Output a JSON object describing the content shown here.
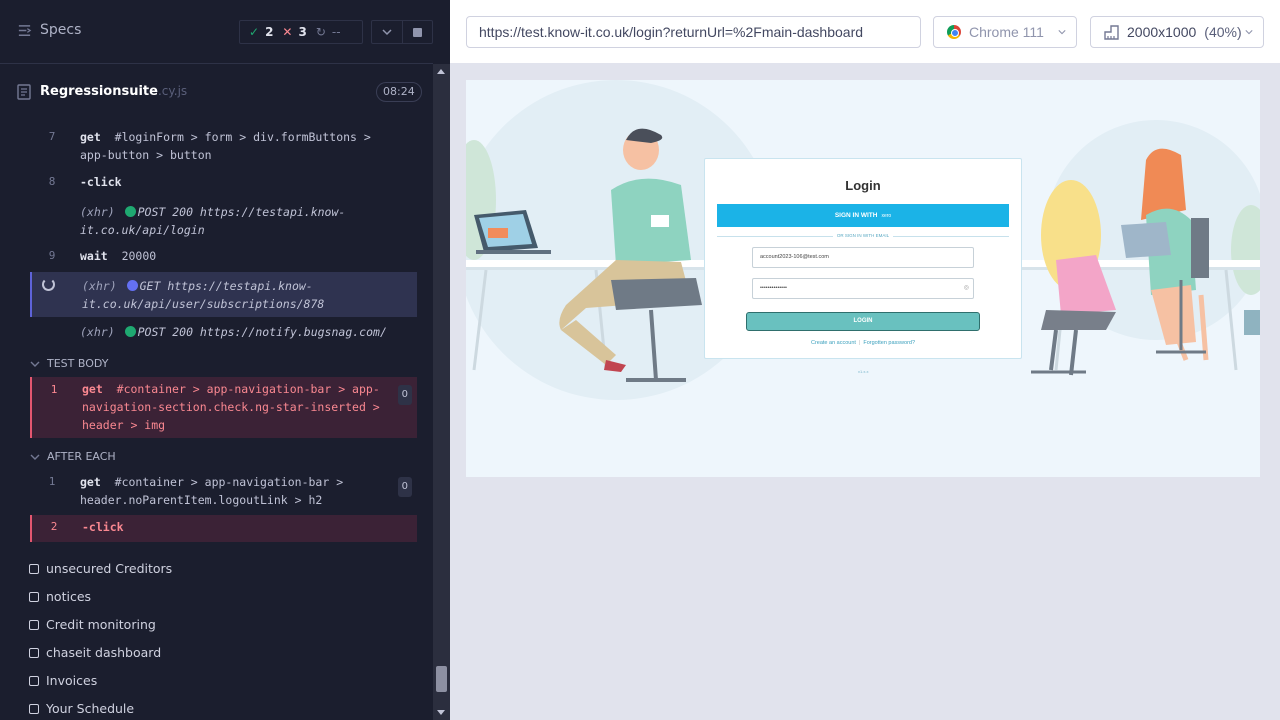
{
  "reporter": {
    "specs_label": "Specs",
    "stats": {
      "passed": "2",
      "failed": "3",
      "pending": "--"
    },
    "spec_name": "Regressionsuite",
    "spec_ext": ".cy.js",
    "duration": "08:24",
    "commands": [
      {
        "num": "7",
        "method": "get",
        "message": "#loginForm > form > div.formButtons > app-button > button"
      },
      {
        "num": "8",
        "method": "-click",
        "message": ""
      },
      {
        "num": "",
        "method": "(xhr)",
        "message": "POST 200 https://testapi.know-it.co.uk/api/login",
        "dot_color": "#1fa971"
      },
      {
        "num": "9",
        "method": "wait",
        "message": "20000"
      },
      {
        "num": "",
        "method": "(xhr)",
        "message": "GET https://testapi.know-it.co.uk/api/user/subscriptions/878",
        "dot_color": "#6470f3"
      },
      {
        "num": "",
        "method": "(xhr)",
        "message": "POST 200 https://notify.bugsnag.com/",
        "dot_color": "#1fa971"
      }
    ],
    "test_body_label": "TEST BODY",
    "test_body_commands": [
      {
        "num": "1",
        "method": "get",
        "message": "#container > app-navigation-bar > app-navigation-section.check.ng-star-inserted > header > img",
        "badge": "0"
      }
    ],
    "after_each_label": "AFTER EACH",
    "after_each_commands": [
      {
        "num": "1",
        "method": "get",
        "message": "#container > app-navigation-bar > header.noParentItem.logoutLink > h2",
        "badge": "0"
      },
      {
        "num": "2",
        "method": "-click",
        "message": ""
      }
    ],
    "tests": [
      "unsecured Creditors",
      "notices",
      "Credit monitoring",
      "chaseit dashboard",
      "Invoices",
      "Your Schedule"
    ]
  },
  "aut": {
    "url": "https://test.know-it.co.uk/login?returnUrl=%2Fmain-dashboard",
    "browser": "Chrome 111",
    "viewport": "2000x1000",
    "scale": "(40%)",
    "app": {
      "title": "Login",
      "sso_label": "SIGN IN WITH",
      "sso_brand": "xero",
      "or_text": "OR SIGN IN WITH EMAIL",
      "email_value": "account2023-106@test.com",
      "password_value": "••••••••••••••",
      "login_button": "LOGIN",
      "create_account": "Create an account",
      "forgot_password": "Forgotten password?",
      "version": "v1.x.x"
    }
  }
}
